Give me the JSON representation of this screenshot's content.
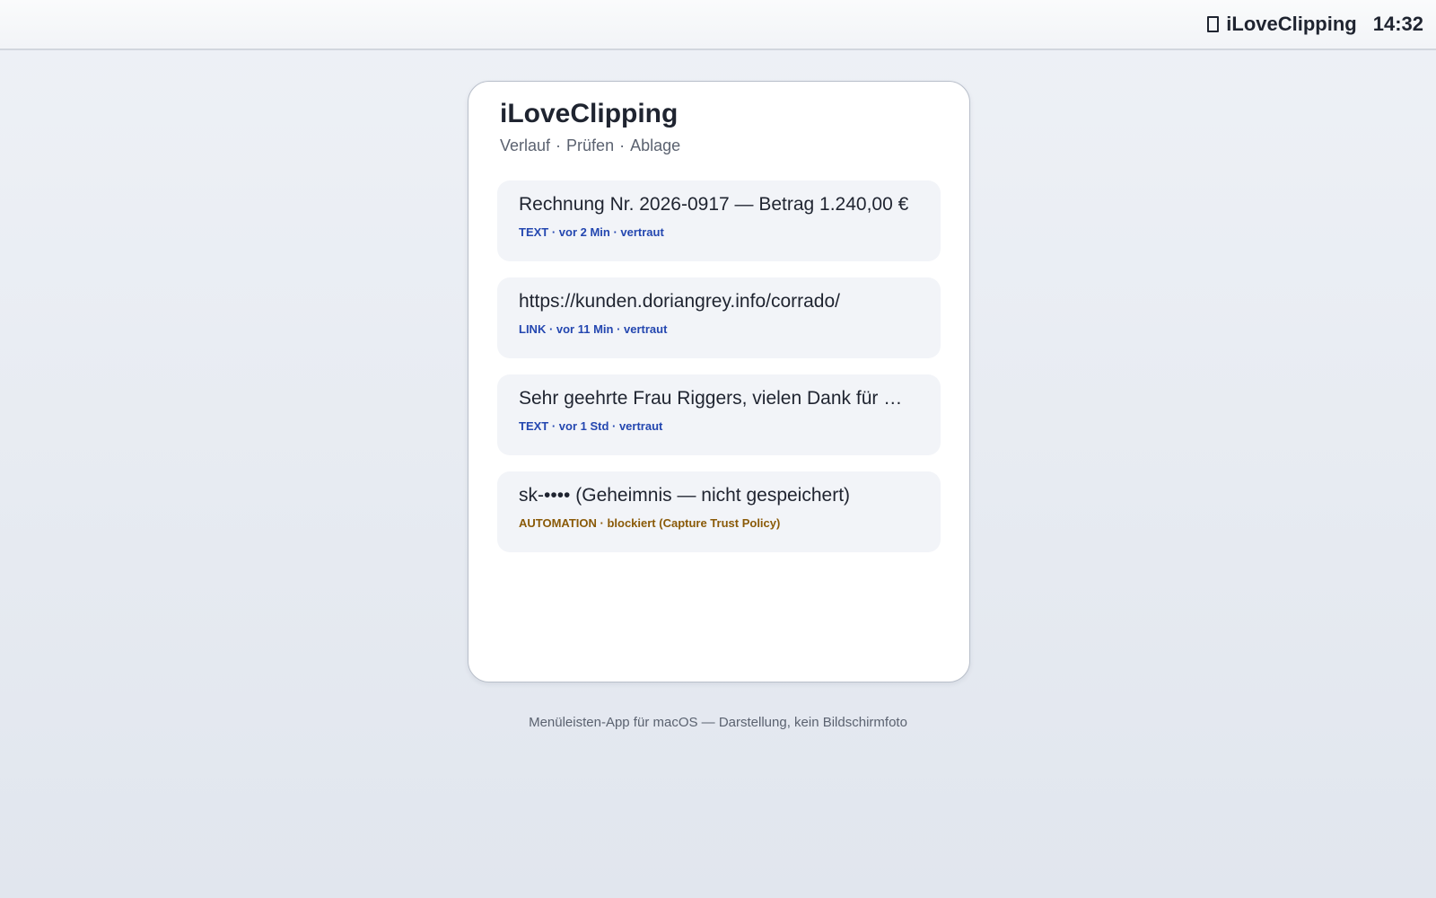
{
  "menubar": {
    "app_icon": "clipboard-icon",
    "app_name": "iLoveClipping",
    "clock": "14:32"
  },
  "panel": {
    "title": "iLoveClipping",
    "nav": [
      {
        "label": "Verlauf"
      },
      {
        "label": "Prüfen"
      },
      {
        "label": "Ablage"
      }
    ],
    "nav_separator": "·"
  },
  "clips": [
    {
      "text": "Rechnung Nr. 2026-0917 — Betrag 1.240,00 €",
      "meta": "TEXT · vor 2 Min · vertraut",
      "status": "trusted"
    },
    {
      "text": "https://kunden.doriangrey.info/corrado/",
      "meta": "LINK · vor 11 Min · vertraut",
      "status": "trusted"
    },
    {
      "text": "Sehr geehrte Frau Riggers, vielen Dank für …",
      "meta": "TEXT · vor 1 Std · vertraut",
      "status": "trusted"
    },
    {
      "text": "sk-•••• (Geheimnis — nicht gespeichert)",
      "meta": "AUTOMATION · blockiert (Capture Trust Policy)",
      "status": "blocked"
    }
  ],
  "footer": "Menüleisten-App für macOS — Darstellung, kein Bildschirmfoto",
  "colors": {
    "trusted_meta": "#2447b0",
    "blocked_meta": "#8a5a08",
    "card_bg": "#f2f4f8"
  }
}
